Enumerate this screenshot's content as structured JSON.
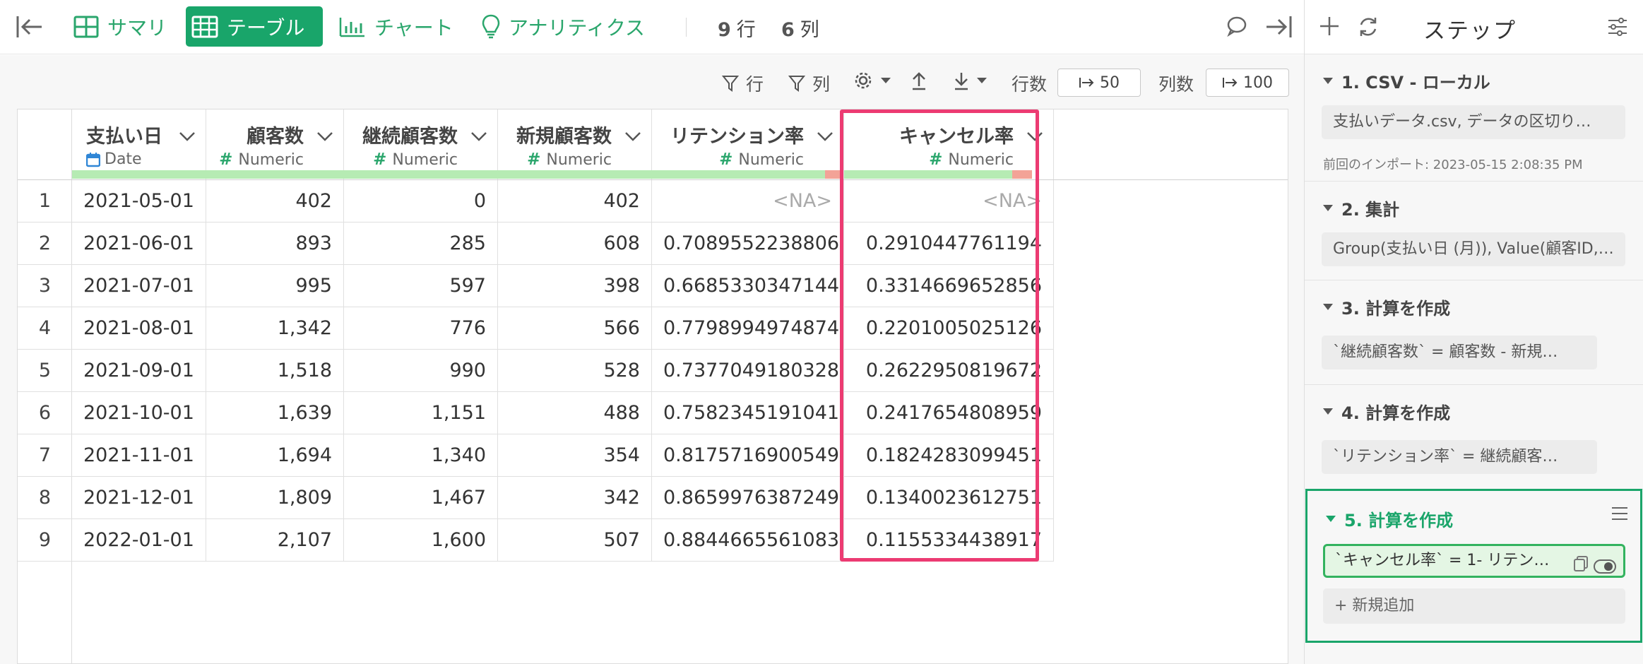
{
  "toolbar": {
    "tabs": [
      {
        "label": "サマリ",
        "icon": "summary-grid-icon"
      },
      {
        "label": "テーブル",
        "icon": "table-icon"
      },
      {
        "label": "チャート",
        "icon": "bar-chart-icon"
      },
      {
        "label": "アナリティクス",
        "icon": "lightbulb-icon"
      }
    ],
    "row_count": "9",
    "row_unit": "行",
    "col_count": "6",
    "col_unit": "列"
  },
  "subtoolbar": {
    "row_filter_label": "行",
    "col_filter_label": "列",
    "rows_label": "行数",
    "rows_value": "50",
    "cols_label": "列数",
    "cols_value": "100"
  },
  "table": {
    "columns": [
      {
        "name": "支払い日",
        "type": "Date"
      },
      {
        "name": "顧客数",
        "type": "Numeric"
      },
      {
        "name": "継続顧客数",
        "type": "Numeric"
      },
      {
        "name": "新規顧客数",
        "type": "Numeric"
      },
      {
        "name": "リテンション率",
        "type": "Numeric"
      },
      {
        "name": "キャンセル率",
        "type": "Numeric"
      }
    ],
    "rows": [
      [
        "1",
        "2021-05-01",
        "402",
        "0",
        "402",
        "<NA>",
        "<NA>"
      ],
      [
        "2",
        "2021-06-01",
        "893",
        "285",
        "608",
        "0.7089552238806",
        "0.2910447761194"
      ],
      [
        "3",
        "2021-07-01",
        "995",
        "597",
        "398",
        "0.6685330347144",
        "0.3314669652856"
      ],
      [
        "4",
        "2021-08-01",
        "1,342",
        "776",
        "566",
        "0.7798994974874",
        "0.2201005025126"
      ],
      [
        "5",
        "2021-09-01",
        "1,518",
        "990",
        "528",
        "0.7377049180328",
        "0.2622950819672"
      ],
      [
        "6",
        "2021-10-01",
        "1,639",
        "1,151",
        "488",
        "0.7582345191041",
        "0.2417654808959"
      ],
      [
        "7",
        "2021-11-01",
        "1,694",
        "1,340",
        "354",
        "0.8175716900549",
        "0.1824283099451"
      ],
      [
        "8",
        "2021-12-01",
        "1,809",
        "1,467",
        "342",
        "0.8659976387249",
        "0.1340023612751"
      ],
      [
        "9",
        "2022-01-01",
        "2,107",
        "1,600",
        "507",
        "0.8844665561083",
        "0.1155334438917"
      ]
    ]
  },
  "steps_panel": {
    "title": "ステップ",
    "steps": [
      {
        "title": "1. CSV - ローカル",
        "body": "支払いデータ.csv, データの区切り…",
        "sub": "前回のインポート: 2023-05-15 2:08:35 PM"
      },
      {
        "title": "2. 集計",
        "body": "Group(支払い日 (月)), Value(顧客ID,…"
      },
      {
        "title": "3. 計算を作成",
        "body": "`継続顧客数` = 顧客数 - 新規…"
      },
      {
        "title": "4. 計算を作成",
        "body": "`リテンション率` = 継続顧客…"
      },
      {
        "title": "5. 計算を作成",
        "body": "`キャンセル率` = 1- リテン…"
      }
    ],
    "add_new": "+ 新規追加"
  }
}
